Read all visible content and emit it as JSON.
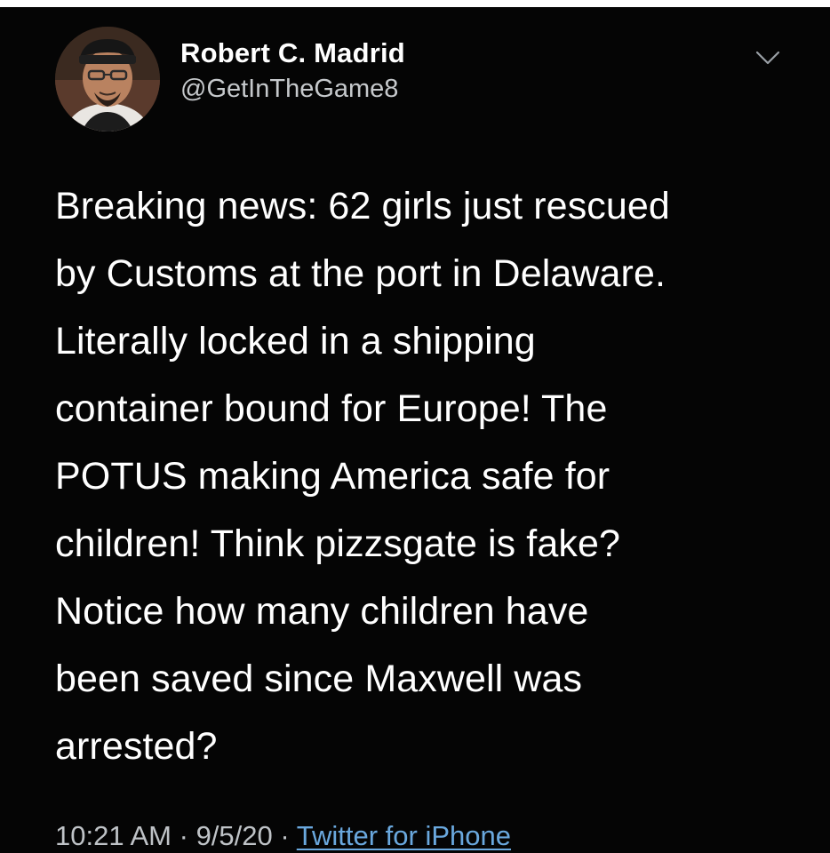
{
  "tweet": {
    "author": {
      "display_name": "Robert C. Madrid",
      "handle": "@GetInTheGame8",
      "avatar_icon": "user-avatar-photo"
    },
    "menu_icon": "chevron-down-icon",
    "text": "Breaking news: 62 girls just rescued\nby Customs at the port in Delaware.\nLiterally locked in a shipping\ncontainer bound for Europe! The\nPOTUS making America safe for\nchildren! Think pizzsgate is fake?\nNotice how many children have\nbeen saved since Maxwell was\narrested?",
    "time": "10:21 AM",
    "separator": "·",
    "date": "9/5/20",
    "source": "Twitter for iPhone"
  },
  "colors": {
    "background": "#050505",
    "text": "#ffffff",
    "secondary_text": "#bfc3c7",
    "link": "#6aa8de"
  }
}
